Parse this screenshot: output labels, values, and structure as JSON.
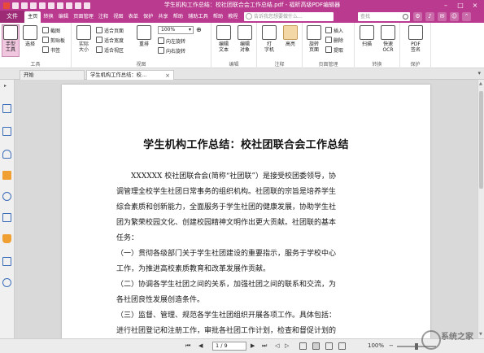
{
  "window": {
    "title": "学生机构工作总结：校社团联合会工作总结.pdf - 福昕高级PDF编辑器",
    "controls": [
      "–",
      "□",
      "×"
    ]
  },
  "ribbon_tabs": {
    "file": "文件",
    "tabs": [
      "主页",
      "转换",
      "编辑",
      "页面管理",
      "注释",
      "视图",
      "表单",
      "保护",
      "共享",
      "帮助",
      "辅助工具",
      "帮助",
      "教程"
    ],
    "active": "主页",
    "tell_me_placeholder": "告诉我您想要做什么...",
    "search_placeholder": "查找"
  },
  "ribbon": {
    "groups": {
      "tools": {
        "label": "工具",
        "hand": "手型\n工具",
        "select": "选择",
        "screenshot": "截图",
        "clipboard": "剪贴板",
        "bookmark": "书签"
      },
      "view": {
        "label": "视图",
        "actual_size": "实际\n大小",
        "fit_page": "适合页面",
        "fit_width": "适合宽度",
        "fit_visible": "适合视区",
        "reflow": "重排",
        "zoom": "100%",
        "rotate_left": "向左旋转",
        "rotate_right": "向右旋转"
      },
      "edit": {
        "label": "编辑",
        "edit_text": "编辑\n文本",
        "edit_object": "编辑\n对象"
      },
      "comment": {
        "label": "注释",
        "typewriter": "打\n字机",
        "highlight": "高亮"
      },
      "page_manage": {
        "label": "页面管理",
        "rotate_page": "旋转\n页面",
        "insert": "插入",
        "delete": "删除",
        "extract": "提取"
      },
      "convert": {
        "label": "转换",
        "scan": "扫描",
        "quick_ocr": "快速\nOCR"
      },
      "protect": {
        "label": "保护",
        "pdf_sign": "PDF\n签名"
      }
    }
  },
  "doc_tabs": [
    {
      "label": "开始",
      "active": false
    },
    {
      "label": "学生机构工作总结：校…",
      "active": true
    }
  ],
  "document": {
    "title": "学生机构工作总结：校社团联合会工作总结",
    "lines": [
      "XXXXXX 校社团联合会(简称“社团联”）是接受校团委领导，协",
      "调管理全校学生社团日常事务的组织机构。社团联的宗旨是培养学生",
      "综合素质和创新能力，全面服务于学生社团的健康发展，协助学生社",
      "团为繁荣校园文化、创建校园精神文明作出更大贡献。社团联的基本",
      "任务：",
      "（一）贯彻各级部门关于学生社团建设的重要指示，服务于学校中心",
      "工作，为推进高校素质教育和改革发展作贡献。",
      "（二）协调各学生社团之间的关系，加强社团之间的联系和交流，为",
      "各社团良性发展创造条件。",
      "（三）监督、管理、规范各学生社团组织开展各项工作。具体包括：",
      "进行社团登记和注册工作，审批各社团工作计划，检查和督促计划的"
    ]
  },
  "status_bar": {
    "page": "1 / 9",
    "zoom": "100%"
  },
  "watermark": "系统之家",
  "colors": {
    "accent": "#b93a8e",
    "file_tab": "#9c2a74"
  }
}
